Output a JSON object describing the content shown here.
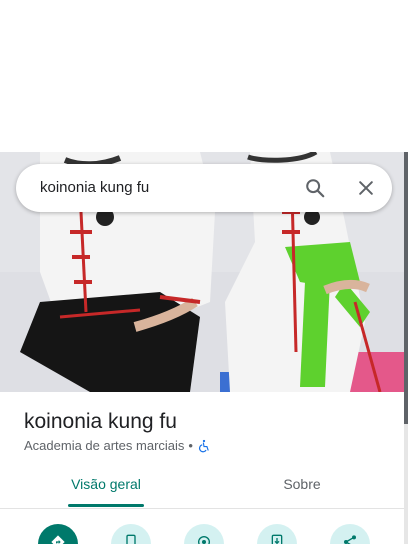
{
  "search": {
    "query": "koinonia kung fu"
  },
  "place": {
    "title": "koinonia kung fu",
    "category": "Academia de artes marciais",
    "separator": "•"
  },
  "tabs": [
    {
      "label": "Visão geral",
      "active": true
    },
    {
      "label": "Sobre",
      "active": false
    }
  ],
  "actions": [
    {
      "icon": "directions-icon"
    },
    {
      "icon": "phone-icon"
    },
    {
      "icon": "location-icon"
    },
    {
      "icon": "save-to-phone-icon"
    },
    {
      "icon": "share-icon"
    }
  ],
  "colors": {
    "accent": "#00796b",
    "action_bg": "#d4f1f1",
    "accessibility_icon": "#1a73e8"
  }
}
